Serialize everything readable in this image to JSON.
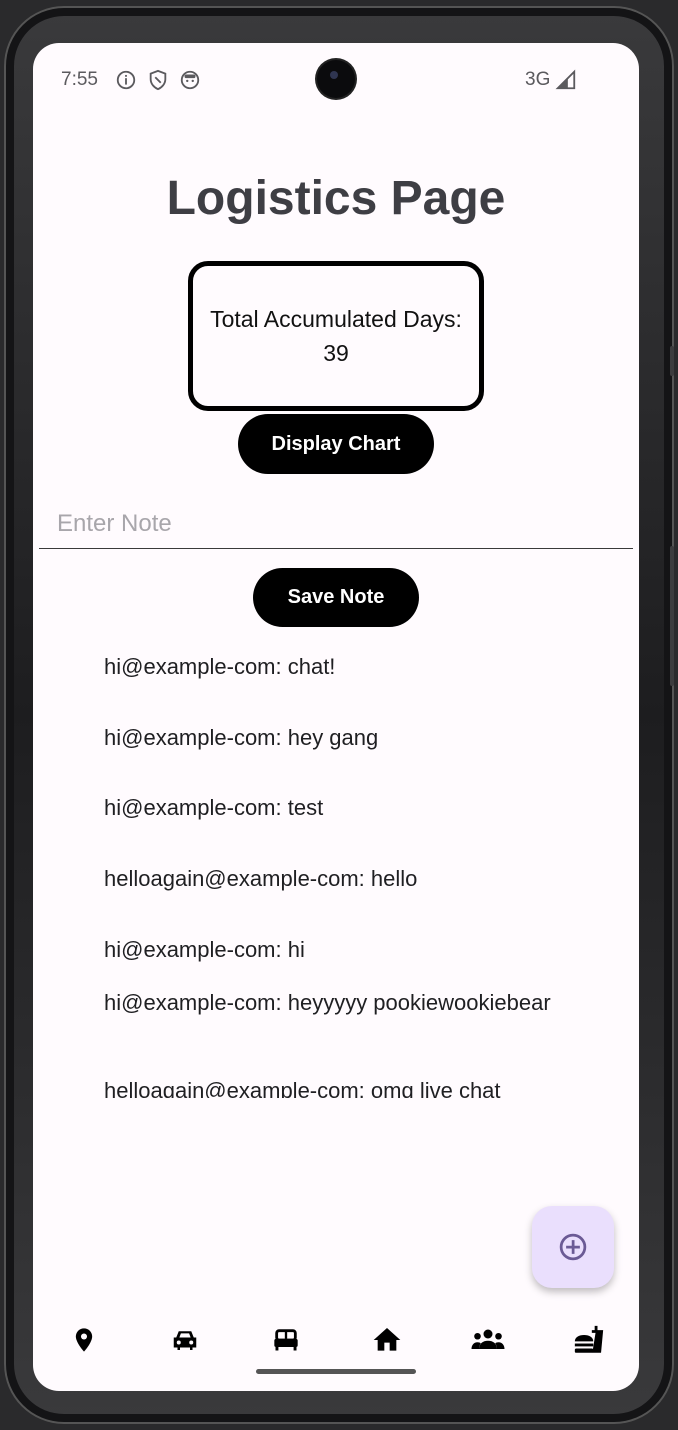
{
  "status_bar": {
    "time": "7:55",
    "network": "3G",
    "icons": [
      "info-icon",
      "shield-icon",
      "face-icon",
      "signal-icon"
    ]
  },
  "page": {
    "title": "Logistics Page",
    "days_label": "Total Accumulated Days:",
    "days_value": "39",
    "display_chart_label": "Display Chart",
    "note_placeholder": "Enter Note",
    "note_value": "",
    "save_note_label": "Save Note"
  },
  "notes": [
    "hi@example-com: chat!",
    "hi@example-com: hey gang",
    "hi@example-com: test",
    "helloagain@example-com: hello",
    "hi@example-com: hi",
    "hi@example-com: heyyyyy pookiewookiebear",
    "helloagain@example-com: omg live chat"
  ],
  "fab": {
    "icon": "add-circle-icon"
  },
  "bottom_nav": [
    {
      "icon": "location-pin-icon"
    },
    {
      "icon": "car-icon"
    },
    {
      "icon": "bed-icon"
    },
    {
      "icon": "home-icon"
    },
    {
      "icon": "group-icon"
    },
    {
      "icon": "fastfood-icon"
    }
  ],
  "colors": {
    "background": "#fffbfe",
    "button": "#000000",
    "fab_background": "#eadffd",
    "fab_icon": "#6b5a95"
  }
}
